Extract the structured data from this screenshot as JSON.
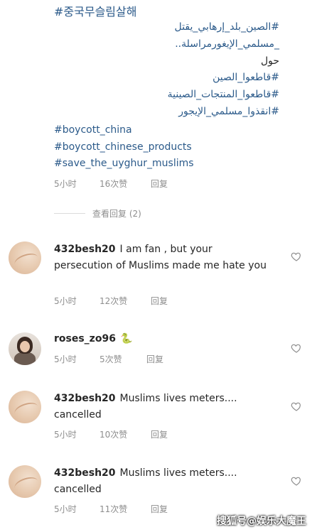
{
  "top_comment": {
    "hashtag_korean": "#중국무슬림살해",
    "arabic_lines": [
      "#الصين_بلد_إرهابي_يقتل",
      "_مسلمي_الإيغورمراسلة..",
      "حول",
      "#قاطعوا_الصين",
      "#قاطعوا_المنتجات_الصينية",
      "#انقذوا_مسلمي_الإيجور"
    ],
    "english_tags": [
      "#boycott_china",
      "#boycott_chinese_products",
      "#save_the_uyghur_muslims"
    ],
    "time": "5小时",
    "likes": "16次赞",
    "reply": "回复"
  },
  "view_replies": "查看回复 (2)",
  "comments": [
    {
      "username": "432besh20",
      "text": "I am fan , but your persecution of Muslims made me hate you",
      "time": "5小时",
      "likes": "12次赞",
      "reply": "回复"
    },
    {
      "username": "roses_zo96",
      "emoji": "🐍",
      "time": "5小时",
      "likes": "5次赞",
      "reply": "回复"
    },
    {
      "username": "432besh20",
      "text": "Muslims lives meters.... cancelled",
      "time": "5小时",
      "likes": "10次赞",
      "reply": "回复"
    },
    {
      "username": "432besh20",
      "text": "Muslims lives meters.... cancelled",
      "time": "5小时",
      "likes": "11次赞",
      "reply": "回复"
    }
  ],
  "watermark": "搜狐号@娱乐大魔王",
  "colors": {
    "hashtag": "#2b5a8a",
    "meta": "#8e8e8e",
    "text": "#262626"
  }
}
